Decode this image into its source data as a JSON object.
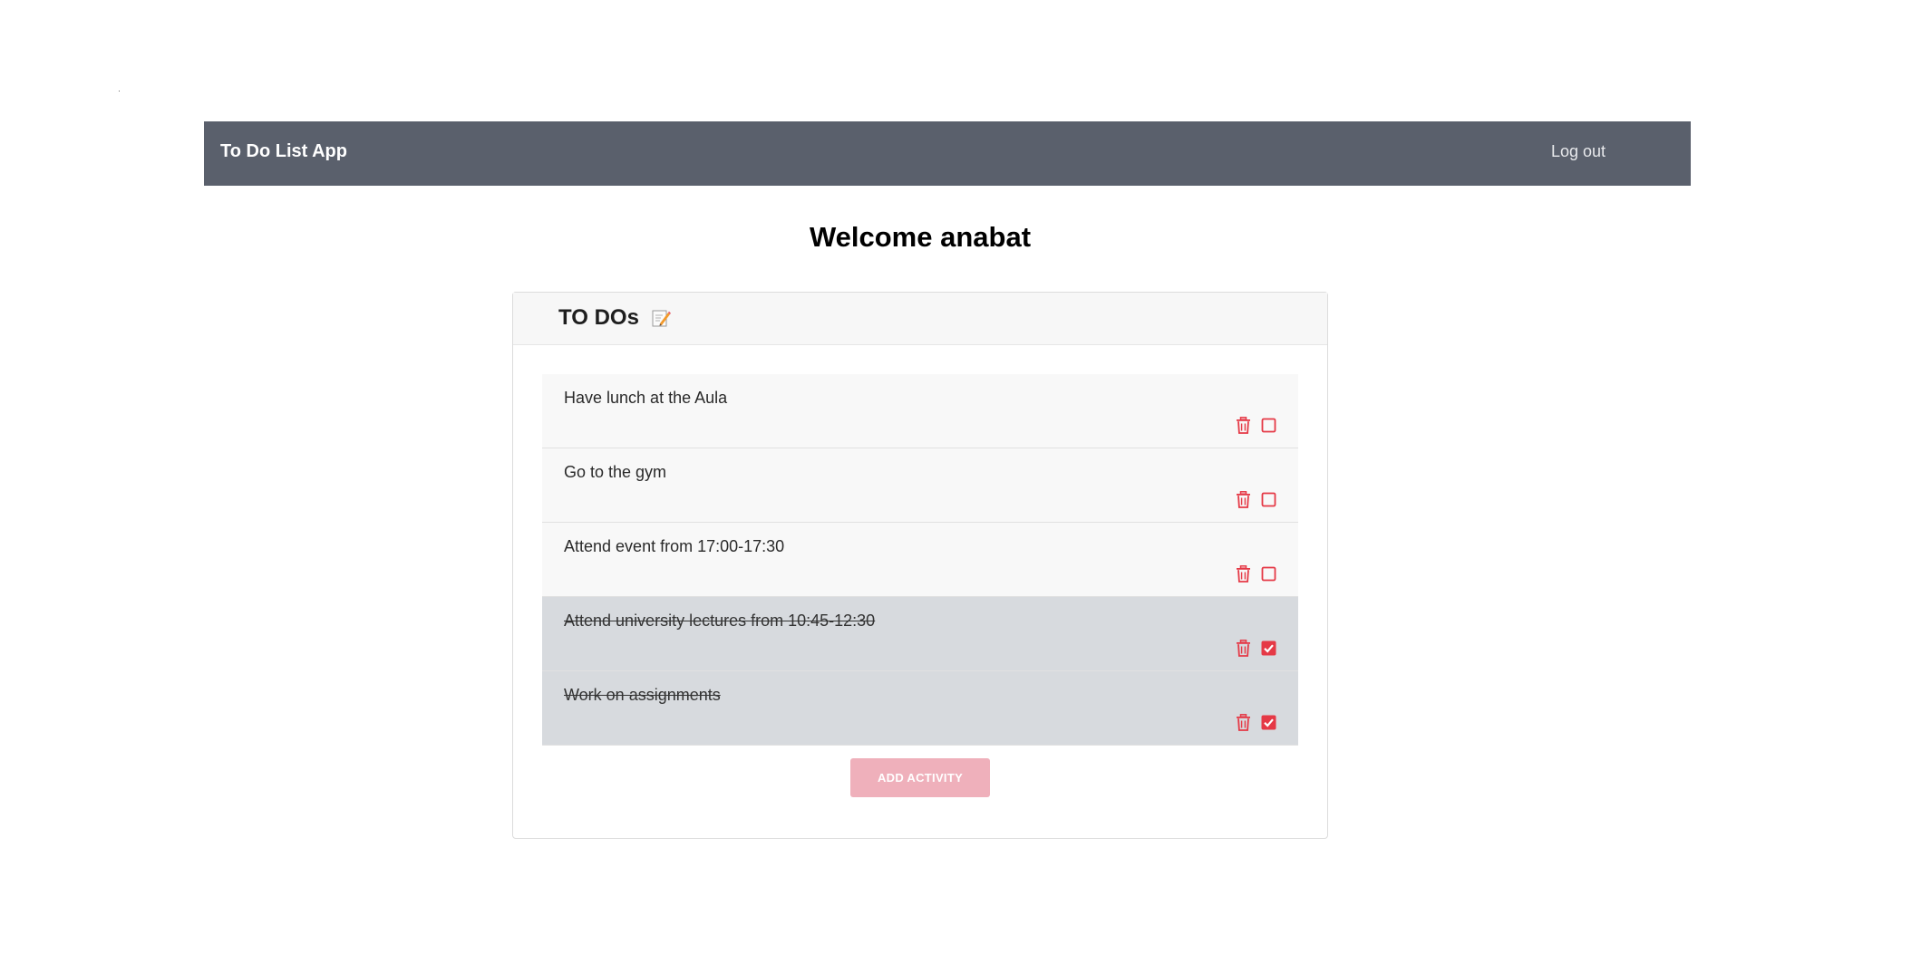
{
  "app": {
    "brand": "To Do List App",
    "logout_label": "Log out"
  },
  "welcome": "Welcome anabat",
  "card": {
    "title": "TO DOs",
    "title_icon": "memo-icon"
  },
  "todos": [
    {
      "text": "Have lunch at the Aula",
      "done": false
    },
    {
      "text": "Go to the gym",
      "done": false
    },
    {
      "text": "Attend event from 17:00-17:30",
      "done": false
    },
    {
      "text": "Attend university lectures from 10:45-12:30",
      "done": true
    },
    {
      "text": "Work on assignments",
      "done": true
    }
  ],
  "add_button_label": "ADD ACTIVITY",
  "colors": {
    "navbar": "#5a606c",
    "accent": "#e53946",
    "add_button": "#efb0bb",
    "done_row": "#d7dade"
  }
}
